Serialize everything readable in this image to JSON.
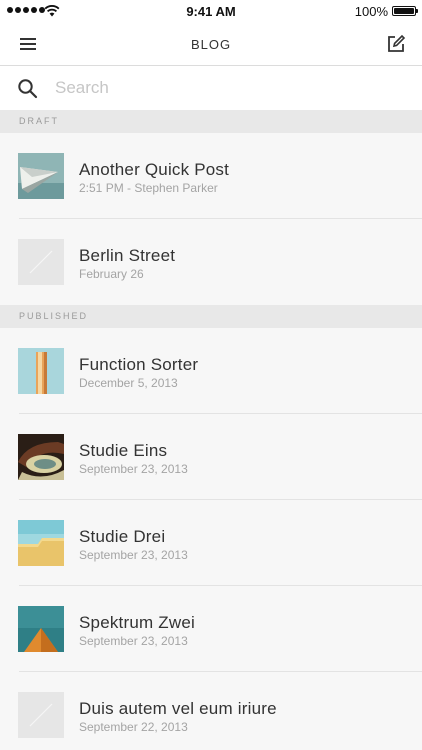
{
  "status_bar": {
    "time": "9:41 AM",
    "battery": "100%"
  },
  "nav": {
    "title": "BLOG",
    "menu_icon": "hamburger-menu-icon",
    "compose_icon": "compose-icon"
  },
  "search": {
    "placeholder": "Search",
    "value": "",
    "icon": "search-icon"
  },
  "sections": [
    {
      "label": "DRAFT",
      "posts": [
        {
          "title": "Another Quick Post",
          "meta": "2:51 PM - Stephen Parker",
          "thumb": "paper-plane-architecture"
        },
        {
          "title": "Berlin Street",
          "meta": "February 26",
          "thumb": "placeholder"
        }
      ]
    },
    {
      "label": "PUBLISHED",
      "posts": [
        {
          "title": "Function Sorter",
          "meta": "December 5, 2013",
          "thumb": "orange-tower"
        },
        {
          "title": "Studie Eins",
          "meta": "September 23, 2013",
          "thumb": "spiral-balcony"
        },
        {
          "title": "Studie Drei",
          "meta": "September 23, 2013",
          "thumb": "yellow-wall-sky"
        },
        {
          "title": "Spektrum Zwei",
          "meta": "September 23, 2013",
          "thumb": "orange-pyramid"
        },
        {
          "title": "Duis autem vel eum iriure",
          "meta": "September 22, 2013",
          "thumb": "placeholder"
        }
      ]
    }
  ],
  "colors": {
    "background": "#f7f7f7",
    "section_header": "#e8e8e8",
    "title_text": "#333333",
    "meta_text": "#a4a4a4"
  }
}
